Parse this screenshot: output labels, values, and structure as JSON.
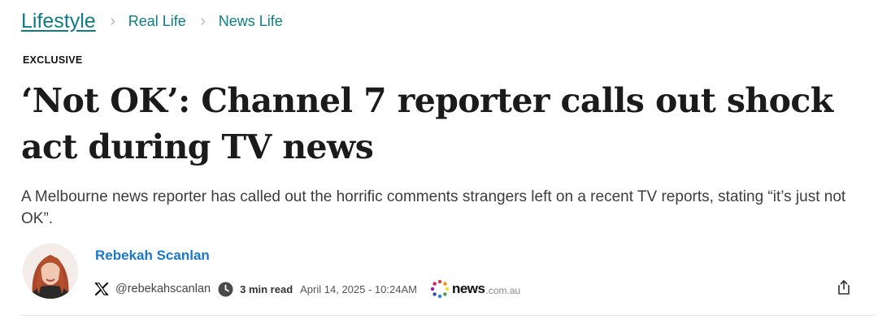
{
  "breadcrumb": {
    "root": "Lifestyle",
    "items": [
      "Real Life",
      "News Life"
    ],
    "separator": "›"
  },
  "article": {
    "tag": "EXCLUSIVE",
    "headline": "‘Not OK’: Channel 7 reporter calls out shock act during TV news",
    "standfirst": "A Melbourne news reporter has called out the horrific comments strangers left on a recent TV reports, stating “it’s just not OK”."
  },
  "byline": {
    "author": "Rebekah Scanlan",
    "handle": "@rebekahscanlan",
    "read_time": "3 min read",
    "date": "April 14, 2025 - 10:24AM",
    "source_logo": {
      "name": "news",
      "domain": ".com.au"
    }
  },
  "icons": {
    "social": "x-icon",
    "clock": "clock-icon",
    "share": "share-icon",
    "logo": "news-logo-dots"
  },
  "colors": {
    "link": "#0e7c86",
    "author": "#1a78c8",
    "headline": "#1b1b1b"
  }
}
